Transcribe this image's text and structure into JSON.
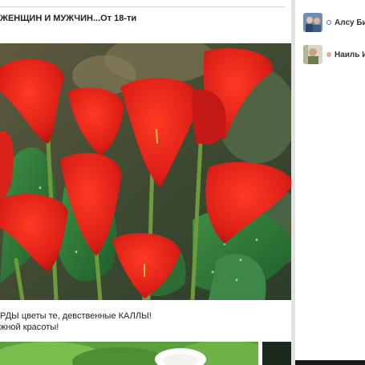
{
  "post": {
    "title": "ЖЕНЩИН И МУЖЧИН...От 18-ти",
    "caption_line1": "РДЫ цветы те, девственные КАЛЛЫ!",
    "caption_line2": "жной красоты!"
  },
  "sidebar": {
    "contacts": [
      {
        "name": "Алсу Би",
        "status_color": "#4a76a8",
        "avatar": "avatar-photo"
      },
      {
        "name": "Наиль И",
        "status_color": "#f0a28a",
        "avatar": "avatar-photo"
      }
    ]
  },
  "colors": {
    "accent_online": "#4a76a8",
    "flower_red": "#e0281c",
    "leaf_green": "#2f7a3a"
  }
}
